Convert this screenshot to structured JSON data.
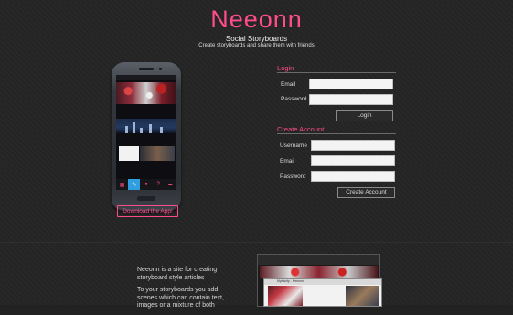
{
  "brand": {
    "logo": "Neeonn",
    "subtitle": "Social Storyboards",
    "tagline": "Create storyboards and share them with friends",
    "accent_color": "#ff4c8b"
  },
  "phone": {
    "tabs": [
      {
        "icon": "grid-icon",
        "glyph": "▦"
      },
      {
        "icon": "brush-icon",
        "glyph": "✎",
        "active": true
      },
      {
        "icon": "person-icon",
        "glyph": "●"
      },
      {
        "icon": "question-icon",
        "glyph": "?"
      },
      {
        "icon": "share-icon",
        "glyph": "➦"
      }
    ]
  },
  "download_button": "Download the App!",
  "login": {
    "title": "Login",
    "email_label": "Email",
    "password_label": "Password",
    "email_value": "",
    "password_value": "",
    "submit_label": "Login"
  },
  "create_account": {
    "title": "Create Account",
    "username_label": "Username",
    "email_label": "Email",
    "password_label": "Password",
    "username_value": "",
    "email_value": "",
    "password_value": "",
    "submit_label": "Create Account"
  },
  "about": {
    "p1": "Neeonn is a site for creating storyboard style articles",
    "p2": "To your storyboards you add scenes which can contain text, images or a mixture of both"
  },
  "preview": {
    "story_title": "Mythicity - Neeonn"
  }
}
